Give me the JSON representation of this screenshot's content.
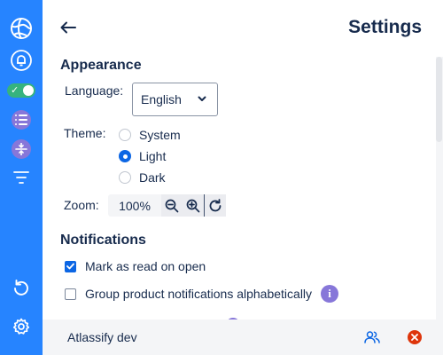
{
  "colors": {
    "rail": "#2684ff",
    "accent": "#0c66e4",
    "purple": "#8777d9",
    "toggle_on": "#36b37e",
    "danger": "#de350b",
    "text": "#172b4d"
  },
  "rail": {
    "items": [
      {
        "icon": "globe-icon"
      },
      {
        "icon": "bell-icon"
      },
      {
        "icon": "toggle-switch",
        "state": "on"
      },
      {
        "icon": "list-icon"
      },
      {
        "icon": "compress-icon"
      },
      {
        "icon": "filter-icon"
      },
      {
        "icon": "undo-icon"
      },
      {
        "icon": "gear-icon"
      }
    ]
  },
  "header": {
    "back_icon": "arrow-left-icon",
    "title": "Settings"
  },
  "appearance": {
    "heading": "Appearance",
    "language_label": "Language:",
    "language_value": "English",
    "theme_label": "Theme:",
    "theme_options": [
      {
        "label": "System",
        "selected": false
      },
      {
        "label": "Light",
        "selected": true
      },
      {
        "label": "Dark",
        "selected": false
      }
    ],
    "zoom_label": "Zoom:",
    "zoom_value": "100%"
  },
  "notifications": {
    "heading": "Notifications",
    "options": [
      {
        "label": "Mark as read on open",
        "checked": true
      },
      {
        "label": "Group product notifications alphabetically",
        "checked": false,
        "info": true
      }
    ]
  },
  "footer": {
    "name": "Atlassify dev"
  }
}
